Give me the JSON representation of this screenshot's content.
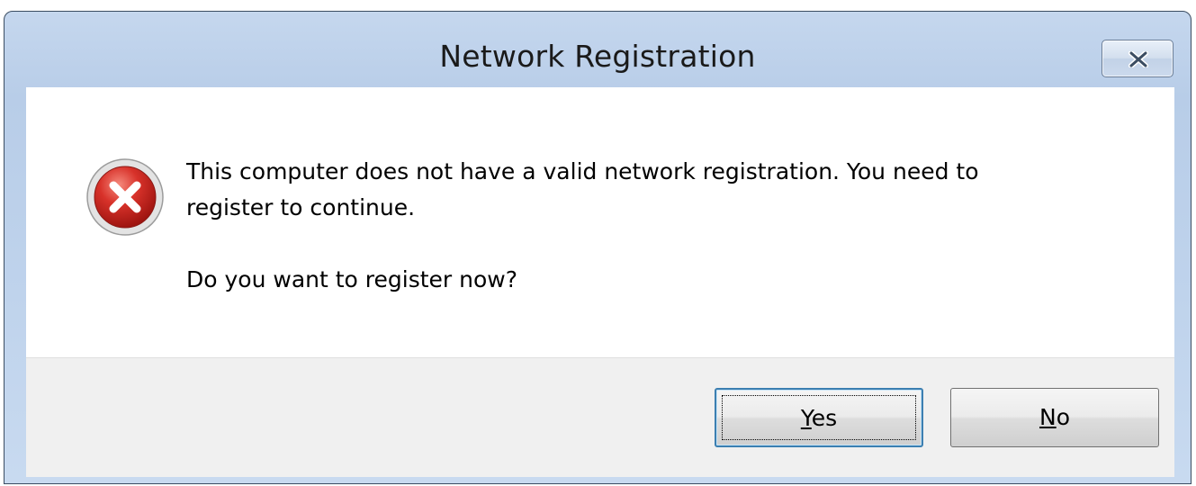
{
  "window": {
    "title": "Network Registration"
  },
  "icons": {
    "close": "close-icon",
    "status": "error-icon"
  },
  "colors": {
    "titlebar": "#bfd3ec",
    "error_icon": "#c9302c",
    "focus_border": "#3c7fb1",
    "button_area": "#f0f0f0"
  },
  "message": {
    "line1": "This computer does not have a valid network registration.  You need to",
    "line2": "register to continue.",
    "question": "Do you want to register now?"
  },
  "buttons": {
    "yes": {
      "accel": "Y",
      "rest": "es",
      "label": "Yes",
      "focused": true
    },
    "no": {
      "accel": "N",
      "rest": "o",
      "label": "No",
      "focused": false
    }
  }
}
